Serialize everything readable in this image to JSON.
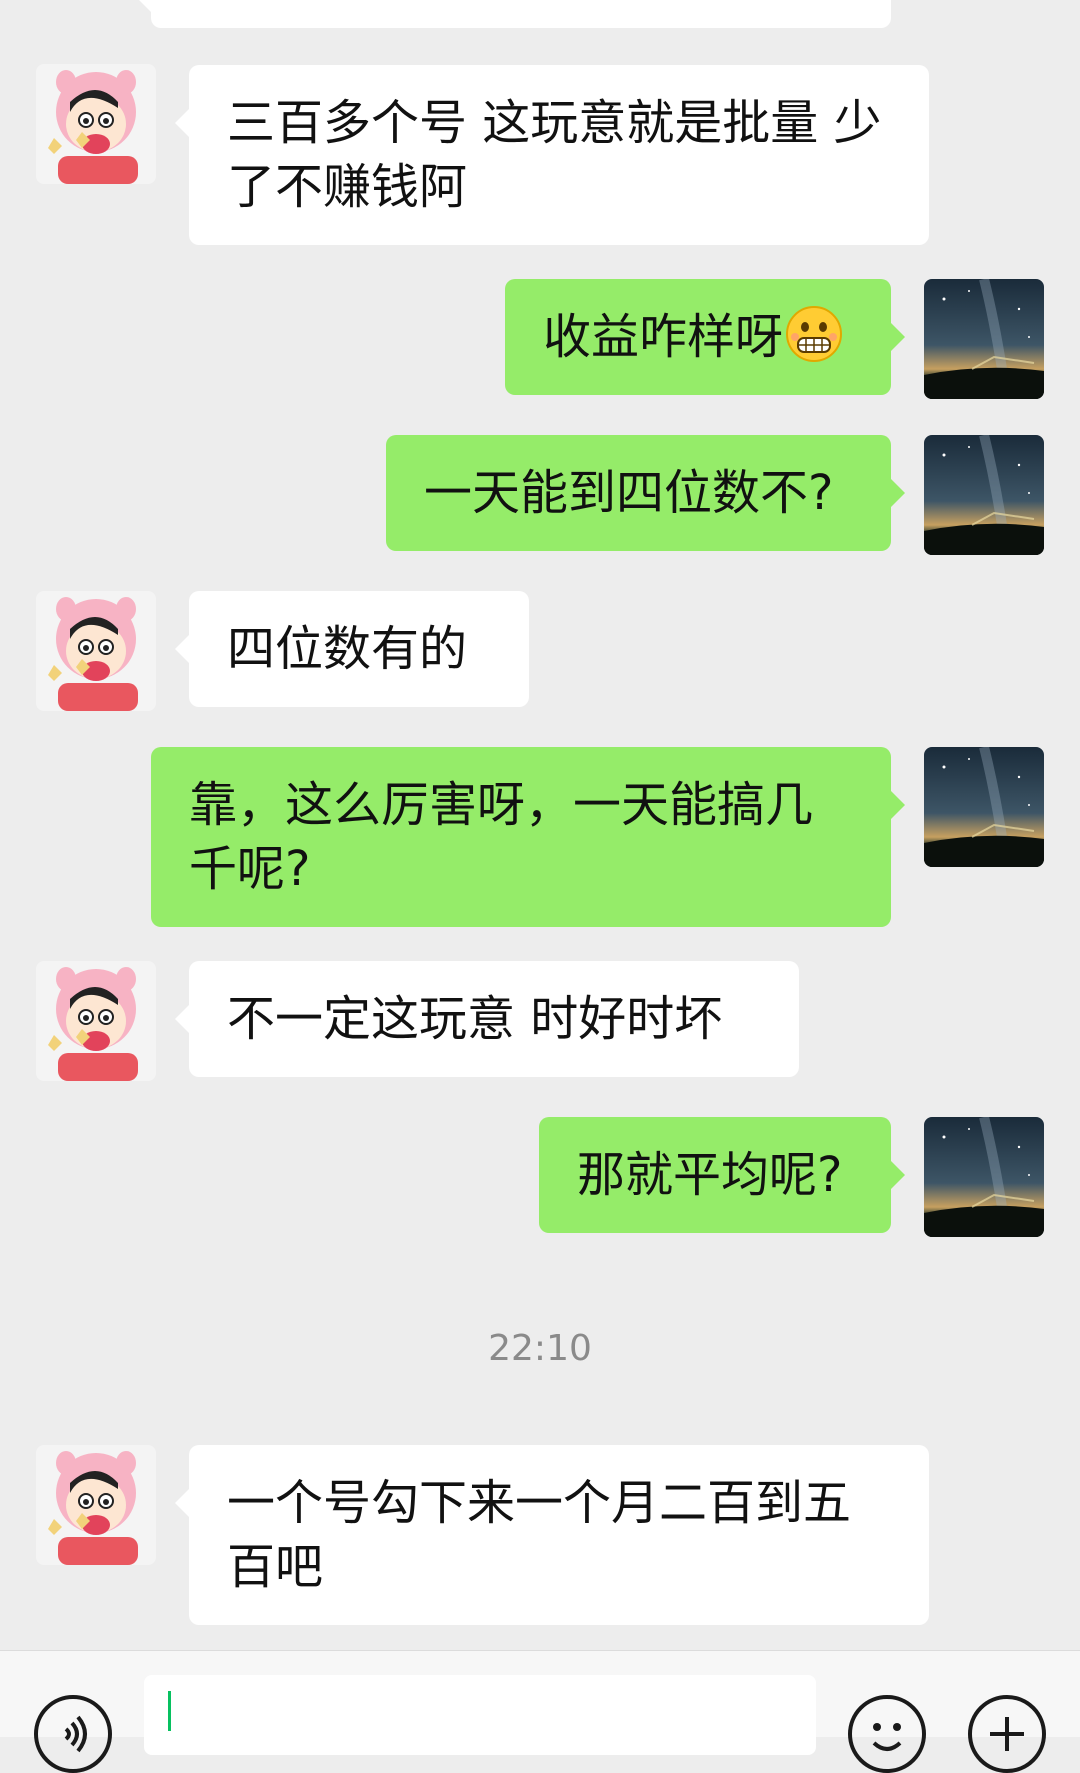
{
  "messages": [
    {
      "side": "left",
      "text": "三百多个号 这玩意就是批量 少了不赚钱阿"
    },
    {
      "side": "right",
      "text": "收益咋样呀",
      "emoji": "grinning-face-emoji"
    },
    {
      "side": "right",
      "text": "一天能到四位数不?"
    },
    {
      "side": "left",
      "text": "四位数有的"
    },
    {
      "side": "right",
      "text": "靠，这么厉害呀，一天能搞几千呢?"
    },
    {
      "side": "left",
      "text": "不一定这玩意 时好时坏"
    },
    {
      "side": "right",
      "text": "那就平均呢?"
    },
    {
      "side": "left",
      "text": "一个号勾下来一个月二百到五百吧"
    }
  ],
  "timestamp": "22:10",
  "icons": {
    "voice": "voice-icon",
    "emoji": "emoji-icon",
    "plus": "plus-icon",
    "peer_avatar": "cartoon-avatar",
    "self_avatar": "night-sky-avatar"
  },
  "colors": {
    "background": "#ededed",
    "bubble_self": "#95ec69",
    "bubble_peer": "#ffffff",
    "cursor": "#07c160"
  }
}
